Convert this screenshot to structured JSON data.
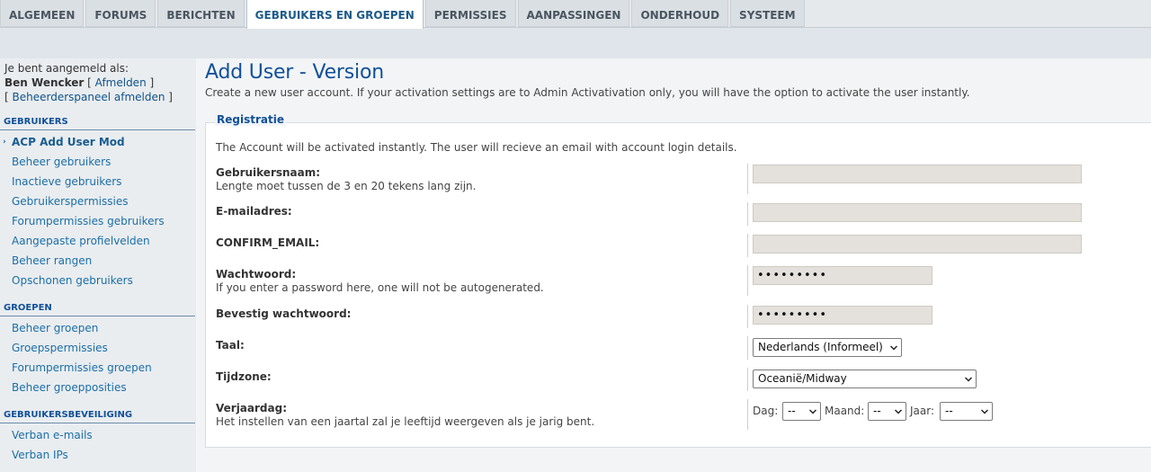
{
  "tabs": [
    {
      "label": "ALGEMEEN",
      "active": false
    },
    {
      "label": "FORUMS",
      "active": false
    },
    {
      "label": "BERICHTEN",
      "active": false
    },
    {
      "label": "GEBRUIKERS EN GROEPEN",
      "active": true
    },
    {
      "label": "PERMISSIES",
      "active": false
    },
    {
      "label": "AANPASSINGEN",
      "active": false
    },
    {
      "label": "ONDERHOUD",
      "active": false
    },
    {
      "label": "SYSTEEM",
      "active": false
    }
  ],
  "sidebar": {
    "logged_in_as": "Je bent aangemeld als:",
    "username": "Ben Wencker",
    "logout_link": "Afmelden",
    "admin_logout_link": "Beheerderspaneel afmelden",
    "sections": [
      {
        "heading": "GEBRUIKERS",
        "items": [
          {
            "label": "ACP Add User Mod",
            "current": true
          },
          {
            "label": "Beheer gebruikers"
          },
          {
            "label": "Inactieve gebruikers"
          },
          {
            "label": "Gebruikerspermissies"
          },
          {
            "label": "Forumpermissies gebruikers"
          },
          {
            "label": "Aangepaste profielvelden"
          },
          {
            "label": "Beheer rangen"
          },
          {
            "label": "Opschonen gebruikers"
          }
        ]
      },
      {
        "heading": "GROEPEN",
        "items": [
          {
            "label": "Beheer groepen"
          },
          {
            "label": "Groepspermissies"
          },
          {
            "label": "Forumpermissies groepen"
          },
          {
            "label": "Beheer groepposities"
          }
        ]
      },
      {
        "heading": "GEBRUIKERSBEVEILIGING",
        "items": [
          {
            "label": "Verban e-mails"
          },
          {
            "label": "Verban IPs"
          }
        ]
      }
    ]
  },
  "main": {
    "title": "Add User - Version",
    "description": "Create a new user account. If your activation settings are to Admin Activativation only, you will have the option to activate the user instantly.",
    "fieldset": {
      "legend": "Registratie",
      "note": "The Account will be activated instantly. The user will recieve an email with account login details.",
      "fields": {
        "username": {
          "label": "Gebruikersnaam:",
          "explain": "Lengte moet tussen de 3 en 20 tekens lang zijn.",
          "value": ""
        },
        "email": {
          "label": "E-mailadres:",
          "value": ""
        },
        "confirm_email": {
          "label": "CONFIRM_EMAIL:",
          "value": ""
        },
        "password": {
          "label": "Wachtwoord:",
          "explain": "If you enter a password here, one will not be autogenerated.",
          "value": "•••••••••"
        },
        "password_confirm": {
          "label": "Bevestig wachtwoord:",
          "value": "•••••••••"
        },
        "language": {
          "label": "Taal:",
          "selected": "Nederlands (Informeel)"
        },
        "timezone": {
          "label": "Tijdzone:",
          "selected": "Oceanië/Midway"
        },
        "birthday": {
          "label": "Verjaardag:",
          "explain": "Het instellen van een jaartal zal je leeftijd weergeven als je jarig bent.",
          "day_label": "Dag:",
          "day_value": "--",
          "month_label": "Maand:",
          "month_value": "--",
          "year_label": "Jaar:",
          "year_value": "--"
        }
      }
    }
  },
  "colors": {
    "accent": "#115098",
    "link": "#1c6ea6",
    "input_bg": "#e4e1dc"
  }
}
